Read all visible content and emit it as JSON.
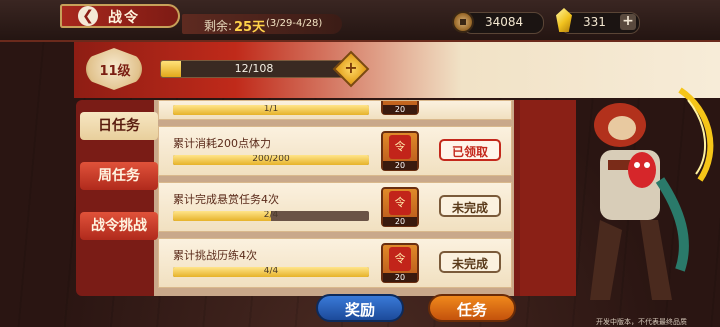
{
  "header": {
    "title": "战令",
    "back_icon": "back-arrow-icon",
    "remaining_label": "剩余:",
    "remaining_days": "25天",
    "date_range": "(3/29-4/28)"
  },
  "resources": {
    "coins": "34084",
    "gems": "331",
    "add_label": "+"
  },
  "level": {
    "label": "11级",
    "xp_text": "12/108",
    "xp_fraction": 0.11,
    "plus_label": "+"
  },
  "tabs": [
    {
      "label": "日任务",
      "active": true
    },
    {
      "label": "周任务",
      "active": false
    },
    {
      "label": "战令挑战",
      "active": false
    }
  ],
  "tasks": [
    {
      "title": "",
      "progress_text": "1/1",
      "fraction": 1.0,
      "reward_count": "20",
      "status": ""
    },
    {
      "title": "累计消耗200点体力",
      "progress_text": "200/200",
      "fraction": 1.0,
      "reward_count": "20",
      "status": "已领取",
      "status_type": "claimed"
    },
    {
      "title": "累计完成悬赏任务4次",
      "progress_text": "2/4",
      "fraction": 0.5,
      "reward_count": "20",
      "status": "未完成",
      "status_type": "pending"
    },
    {
      "title": "累计挑战历练4次",
      "progress_text": "4/4",
      "fraction": 1.0,
      "reward_count": "20",
      "status": "未完成",
      "status_type": "pending"
    }
  ],
  "bottom_buttons": {
    "reward": "奖励",
    "task": "任务"
  },
  "watermark": "开发中版本，不代表最终品质",
  "colors": {
    "accent_red": "#c4281c",
    "gold": "#f0c21e",
    "blue_button": "#3a7ad8",
    "orange_button": "#f0891c"
  }
}
